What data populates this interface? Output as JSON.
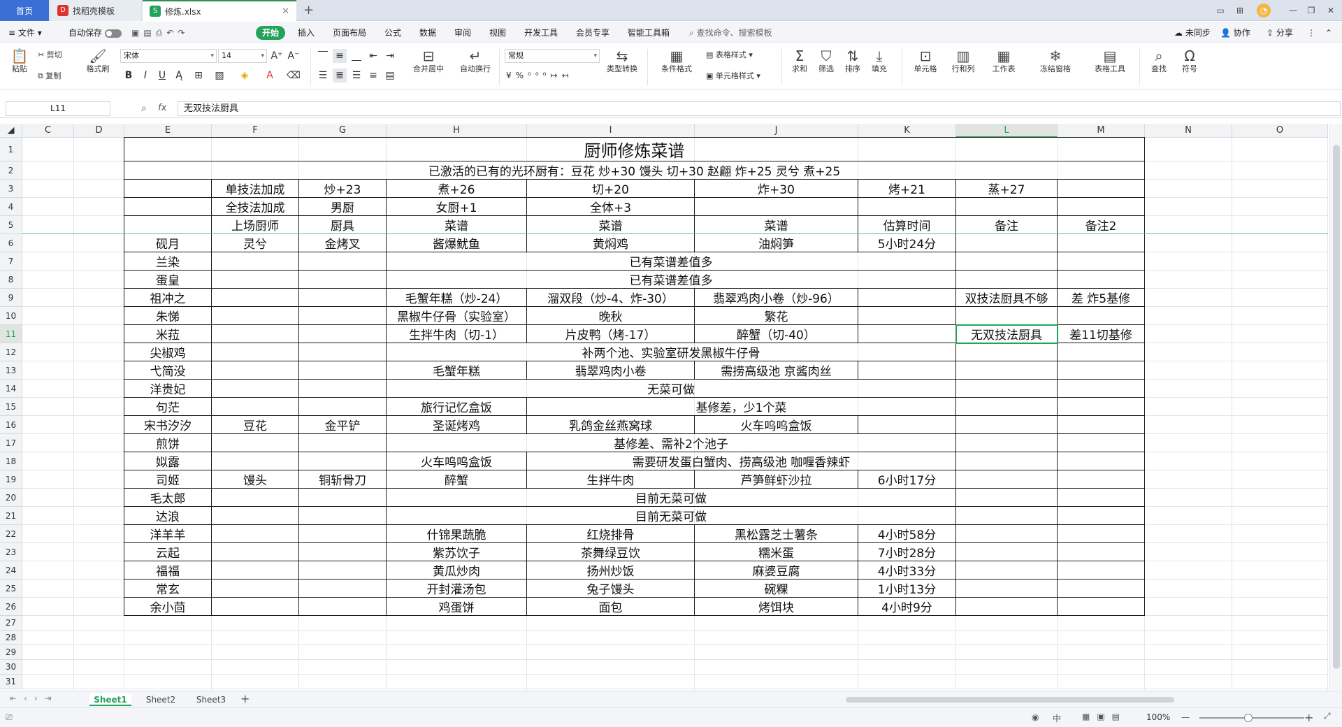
{
  "tabs": {
    "home": "首页",
    "template": "找稻壳模板",
    "file": "修炼.xlsx"
  },
  "menu": {
    "file": "文件",
    "autosave": "自动保存",
    "items": [
      "开始",
      "插入",
      "页面布局",
      "公式",
      "数据",
      "审阅",
      "视图",
      "开发工具",
      "会员专享",
      "智能工具箱"
    ],
    "search": "查找命令、搜索模板",
    "sync": "未同步",
    "collab": "协作",
    "share": "分享"
  },
  "ribbon": {
    "paste": "粘贴",
    "cut": "剪切",
    "copy": "复制",
    "format_painter": "格式刷",
    "font_name": "宋体",
    "font_size": "14",
    "merge": "合并居中",
    "wrap": "自动换行",
    "num_format": "常规",
    "type_convert": "类型转换",
    "cond_format": "条件格式",
    "table_style": "表格样式",
    "cell_style": "单元格样式",
    "sum": "求和",
    "filter": "筛选",
    "sort": "排序",
    "fill": "填充",
    "cells": "单元格",
    "rowcol": "行和列",
    "worksheet": "工作表",
    "freeze": "冻结窗格",
    "table_tools": "表格工具",
    "find": "查找",
    "symbol": "符号"
  },
  "formula": {
    "cell_ref": "L11",
    "content": "无双技法厨具",
    "fx": "fx"
  },
  "columns": [
    "C",
    "D",
    "E",
    "F",
    "G",
    "H",
    "I",
    "J",
    "K",
    "L",
    "M",
    "N",
    "O"
  ],
  "rows": [
    "1",
    "2",
    "3",
    "4",
    "5",
    "6",
    "7",
    "8",
    "9",
    "10",
    "11",
    "12",
    "13",
    "14",
    "15",
    "16",
    "17",
    "18",
    "19",
    "20",
    "21",
    "22",
    "23",
    "24",
    "25",
    "26",
    "27",
    "28",
    "29",
    "30",
    "31"
  ],
  "sheet": {
    "title": "厨师修炼菜谱",
    "aura": "已激活的已有的光环厨有：豆花 炒+30 馒头 切+30 赵翩 炸+25 灵兮 煮+25",
    "r3": [
      "单技法加成",
      "炒+23",
      "煮+26",
      "切+20",
      "炸+30",
      "烤+21",
      "蒸+27"
    ],
    "r4": [
      "全技法加成",
      "男厨",
      "女厨+1",
      "全体+3"
    ],
    "r5": [
      "上场厨师",
      "厨具",
      "菜谱",
      "菜谱",
      "菜谱",
      "估算时间",
      "备注",
      "备注2"
    ],
    "r6": [
      "砚月",
      "灵兮",
      "金烤叉",
      "酱爆鱿鱼",
      "黄焖鸡",
      "油焖笋",
      "5小时24分"
    ],
    "r7": [
      "兰染",
      "已有菜谱差值多"
    ],
    "r8": [
      "蛋皇",
      "已有菜谱差值多"
    ],
    "r9": [
      "祖冲之",
      "毛蟹年糕（炒-24）",
      "溜双段（炒-4、炸-30）",
      "翡翠鸡肉小卷（炒-96）",
      "双技法厨具不够",
      "差 炸5基修"
    ],
    "r10": [
      "朱悌",
      "黑椒牛仔骨（实验室）",
      "晚秋",
      "繁花"
    ],
    "r11": [
      "米菈",
      "生拌牛肉（切-1）",
      "片皮鸭（烤-17）",
      "醉蟹（切-40）",
      "无双技法厨具",
      "差11切基修"
    ],
    "r12": [
      "尖椒鸡",
      "补两个池、实验室研发黑椒牛仔骨"
    ],
    "r13": [
      "弋简没",
      "毛蟹年糕",
      "翡翠鸡肉小卷",
      "需捞高级池 京酱肉丝"
    ],
    "r14": [
      "洋贵妃",
      "无菜可做"
    ],
    "r15": [
      "句茫",
      "旅行记忆盒饭",
      "基修差，少1个菜"
    ],
    "r16": [
      "宋书汐汐",
      "豆花",
      "金平铲",
      "圣诞烤鸡",
      "乳鸽金丝燕窝球",
      "火车呜呜盒饭"
    ],
    "r17": [
      "煎饼",
      "基修差、需补2个池子"
    ],
    "r18": [
      "姒露",
      "火车呜呜盒饭",
      "需要研发蛋白蟹肉、捞高级池 咖喱香辣虾"
    ],
    "r19": [
      "司姬",
      "馒头",
      "铜斩骨刀",
      "醉蟹",
      "生拌牛肉",
      "芦笋鲜虾沙拉",
      "6小时17分"
    ],
    "r20": [
      "毛太郎",
      "目前无菜可做"
    ],
    "r21": [
      "达浪",
      "目前无菜可做"
    ],
    "r22": [
      "洋羊羊",
      "什锦果蔬脆",
      "红烧排骨",
      "黑松露芝士薯条",
      "4小时58分"
    ],
    "r23": [
      "云起",
      "紫苏饮子",
      "茶舞绿豆饮",
      "糯米蛋",
      "7小时28分"
    ],
    "r24": [
      "福福",
      "黄瓜炒肉",
      "扬州炒饭",
      "麻婆豆腐",
      "4小时33分"
    ],
    "r25": [
      "常玄",
      "开封灌汤包",
      "兔子馒头",
      "碗粿",
      "1小时13分"
    ],
    "r26": [
      "余小茴",
      "鸡蛋饼",
      "面包",
      "烤饵块",
      "4小时9分"
    ]
  },
  "sheet_tabs": [
    "Sheet1",
    "Sheet2",
    "Sheet3"
  ],
  "status": {
    "zoom": "100%",
    "lang": "中"
  }
}
